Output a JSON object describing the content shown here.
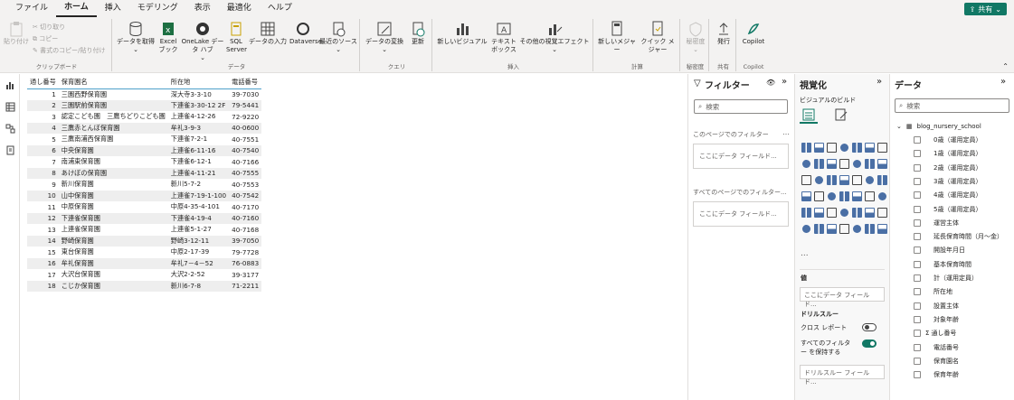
{
  "menubar": {
    "items": [
      "ファイル",
      "ホーム",
      "挿入",
      "モデリング",
      "表示",
      "最適化",
      "ヘルプ"
    ],
    "active": "ホーム",
    "share_label": "共有"
  },
  "ribbon": {
    "clipboard": {
      "paste": "貼り付け",
      "cut": "切り取り",
      "copy": "コピー",
      "format_copy": "書式のコピー/貼り付け",
      "label": "クリップボード"
    },
    "data": {
      "get_data": "データを取得",
      "excel": "Excel ブック",
      "onelake": "OneLake データ ハブ",
      "sql": "SQL Server",
      "enter_data": "データの入力",
      "dataverse": "Dataverse",
      "recent": "最近のソース",
      "label": "データ"
    },
    "query": {
      "transform": "データの変換",
      "refresh": "更新",
      "label": "クエリ"
    },
    "insert": {
      "new_visual": "新しいビジュアル",
      "textbox": "テキスト ボックス",
      "more_visuals": "その他の視覚エフェクト",
      "label": "挿入"
    },
    "calc": {
      "new_measure": "新しいメジャー",
      "quick_measure": "クイック メジャー",
      "label": "計算"
    },
    "sensitivity": {
      "btn": "秘密度",
      "label": "秘密度"
    },
    "share": {
      "publish": "発行",
      "label": "共有"
    },
    "copilot": {
      "btn": "Copilot",
      "label": "Copilot"
    }
  },
  "table": {
    "headers": [
      "通し番号",
      "保育園名",
      "所在地",
      "電話番号"
    ],
    "rows": [
      [
        "1",
        "三園西野保育園",
        "深大寺3-3-10",
        "39-7030"
      ],
      [
        "2",
        "三園駅前保育園",
        "下連雀3-30-12 2F",
        "79-5441"
      ],
      [
        "3",
        "認定こども園　三鷹ちどりこども園",
        "上連雀4-12-26",
        "72-9220"
      ],
      [
        "4",
        "三鷹赤とんぼ保育園",
        "牟礼3-9-3",
        "40-0600"
      ],
      [
        "5",
        "三鷹南浦西保育園",
        "下連雀7-2-1",
        "40-7551"
      ],
      [
        "6",
        "中央保育園",
        "上連雀6-11-16",
        "40-7540"
      ],
      [
        "7",
        "南浦東保育園",
        "下連雀6-12-1",
        "40-7166"
      ],
      [
        "8",
        "あけぼの保育園",
        "上連雀4-11-21",
        "40-7555"
      ],
      [
        "9",
        "新川保育園",
        "新川5-7-2",
        "40-7553"
      ],
      [
        "10",
        "山中保育園",
        "上連雀7-19-1-100",
        "40-7542"
      ],
      [
        "11",
        "中原保育園",
        "中原4-35-4-101",
        "40-7170"
      ],
      [
        "12",
        "下連雀保育園",
        "下連雀4-19-4",
        "40-7160"
      ],
      [
        "13",
        "上連雀保育園",
        "上連雀5-1-27",
        "40-7168"
      ],
      [
        "14",
        "野崎保育園",
        "野崎3-12-11",
        "39-7050"
      ],
      [
        "15",
        "東台保育園",
        "中原2-17-39",
        "79-7728"
      ],
      [
        "16",
        "牟礼保育園",
        "牟礼7－4－52",
        "76-0883"
      ],
      [
        "17",
        "大沢台保育園",
        "大沢2-2-52",
        "39-3177"
      ],
      [
        "18",
        "こじか保育園",
        "新川6-7-8",
        "71-2211"
      ]
    ]
  },
  "filters": {
    "title": "フィルター",
    "search": "検索",
    "page_label": "このページでのフィルター",
    "page_drop": "ここにデータ フィールド...",
    "all_label": "すべてのページでのフィルター...",
    "all_drop": "ここにデータ フィールド..."
  },
  "viz": {
    "title": "視覚化",
    "build": "ビジュアルのビルド",
    "more": "...",
    "values_label": "値",
    "values_drop": "ここにデータ フィールド...",
    "drill_label": "ドリルスルー",
    "cross_report": "クロス レポート",
    "keep_filters": "すべてのフィルター を保持する",
    "drill_drop": "ドリルスルー フィールド..."
  },
  "data": {
    "title": "データ",
    "search": "検索",
    "table_name": "blog_nursery_school",
    "fields": [
      "0歳（運用定員）",
      "1歳（運用定員）",
      "2歳（運用定員）",
      "3歳（運用定員）",
      "4歳（運用定員）",
      "5歳（運用定員）",
      "運営主体",
      "延長保育時間（月～金）",
      "開設年月日",
      "基本保育時間",
      "計（運用定員）",
      "所在地",
      "設置主体",
      "対象年齢",
      "通し番号",
      "電話番号",
      "保育園名",
      "保育年齢"
    ]
  },
  "colors": {
    "accent": "#117865",
    "header_line": "#4ea0c9",
    "toggle_on": "#117865"
  }
}
